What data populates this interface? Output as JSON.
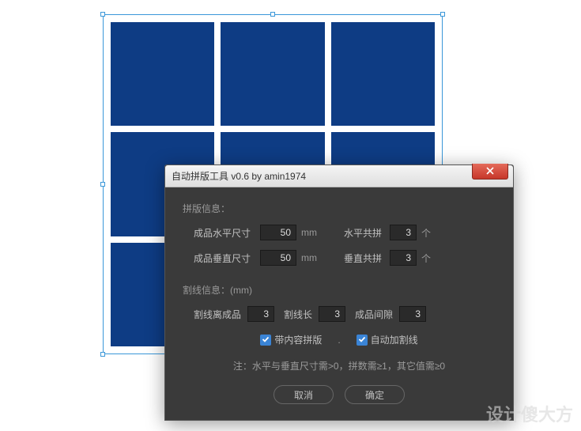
{
  "dialog": {
    "title": "自动拼版工具 v0.6   by amin1974",
    "section1_label": "拼版信息：",
    "hsize_label": "成品水平尺寸",
    "hsize_value": "50",
    "hsize_unit": "mm",
    "hcount_label": "水平共拼",
    "hcount_value": "3",
    "hcount_unit": "个",
    "vsize_label": "成品垂直尺寸",
    "vsize_value": "50",
    "vsize_unit": "mm",
    "vcount_label": "垂直共拼",
    "vcount_value": "3",
    "vcount_unit": "个",
    "section2_label": "割线信息：(mm)",
    "cut_offset_label": "割线离成品",
    "cut_offset_value": "3",
    "cut_len_label": "割线长",
    "cut_len_value": "3",
    "gap_label": "成品间隙",
    "gap_value": "3",
    "chk1_label": "带内容拼版",
    "chk2_label": "自动加割线",
    "note": "注：水平与垂直尺寸需>0，拼数需≥1，其它值需≥0",
    "cancel": "取消",
    "ok": "确定"
  },
  "watermark": "设计傻大方"
}
